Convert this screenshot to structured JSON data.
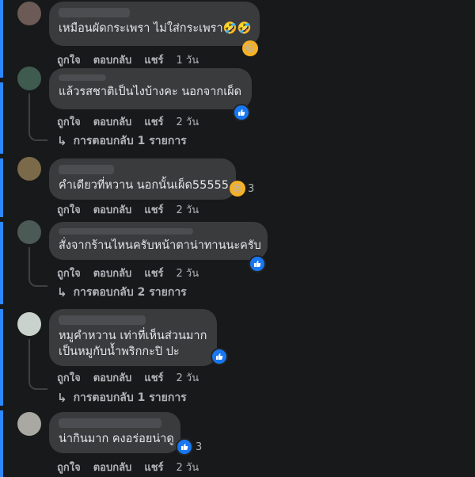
{
  "actions": {
    "like": "ถูกใจ",
    "reply": "ตอบกลับ",
    "share": "แชร์"
  },
  "comments": [
    {
      "text": "เหมือนผัดกระเพรา ไม่ใส่กระเพรา",
      "inline_emoji": "🤣🤣",
      "time": "1 วัน",
      "reaction": "haha"
    },
    {
      "text": "แล้วรสชาติเป็นไงบ้างคะ นอกจากเผ็ด",
      "time": "2 วัน",
      "reaction": "like",
      "replies": "การตอบกลับ 1 รายการ"
    },
    {
      "text": "คำเดียวที่หวาน นอกนั้นเผ็ด55555",
      "time": "2 วัน",
      "reaction": "haha",
      "reaction_count": "3"
    },
    {
      "text": "สั่งจากร้านไหนครับหน้าตาน่าทานนะครับ",
      "time": "2 วัน",
      "reaction": "like",
      "replies": "การตอบกลับ 2 รายการ"
    },
    {
      "text_line1": "หมูคำหวาน เท่าที่เห็นส่วนมาก",
      "text_line2": "เป็นหมูกับน้ำพริกกะปิ ปะ",
      "time": "2 วัน",
      "reaction": "like",
      "replies": "การตอบกลับ 1 รายการ"
    },
    {
      "text": "น่ากินมาก คงอร่อยน่าดู",
      "time": "2 วัน",
      "reaction": "like",
      "reaction_count": "3"
    }
  ],
  "colors": {
    "background": "#18191a",
    "bubble": "#3a3b3c",
    "like": "#1877f2",
    "haha": "#f7b125",
    "accent_bar": "#2d88ff"
  }
}
